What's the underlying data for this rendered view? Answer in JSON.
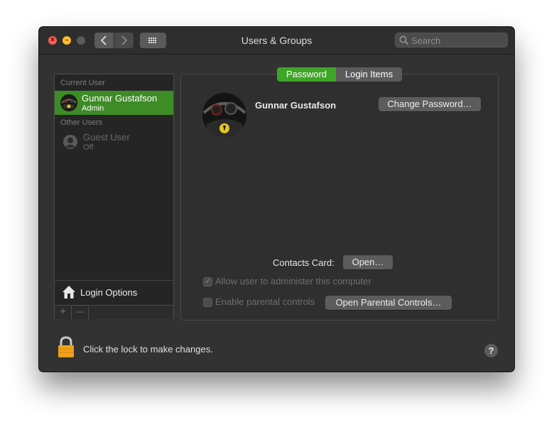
{
  "window": {
    "title": "Users & Groups",
    "search_placeholder": "Search"
  },
  "sidebar": {
    "current_user_header": "Current User",
    "current_user": {
      "name": "Gunnar Gustafson",
      "role": "Admin"
    },
    "other_users_header": "Other Users",
    "other_users": [
      {
        "name": "Guest User",
        "status": "Off"
      }
    ],
    "login_options_label": "Login Options",
    "add_symbol": "+",
    "remove_symbol": "—"
  },
  "tabs": [
    {
      "label": "Password",
      "selected": true
    },
    {
      "label": "Login Items",
      "selected": false
    }
  ],
  "main": {
    "user_name": "Gunnar Gustafson",
    "change_password_label": "Change Password…",
    "contacts_card_label": "Contacts Card:",
    "open_label": "Open…",
    "allow_admin_label": "Allow user to administer this computer",
    "allow_admin_checked": true,
    "parental_label": "Enable parental controls",
    "parental_checked": false,
    "open_parental_label": "Open Parental Controls…"
  },
  "footer": {
    "lock_text": "Click the lock to make changes.",
    "help_symbol": "?"
  },
  "colors": {
    "accent_green": "#3ea627",
    "selection_green": "#3d8c26",
    "window_bg": "#323232"
  },
  "icons": [
    "close-icon",
    "minimize-icon",
    "chevron-left-icon",
    "chevron-right-icon",
    "grid-icon",
    "search-icon",
    "avatar-icon",
    "guest-user-icon",
    "house-icon",
    "lock-icon",
    "help-icon"
  ]
}
